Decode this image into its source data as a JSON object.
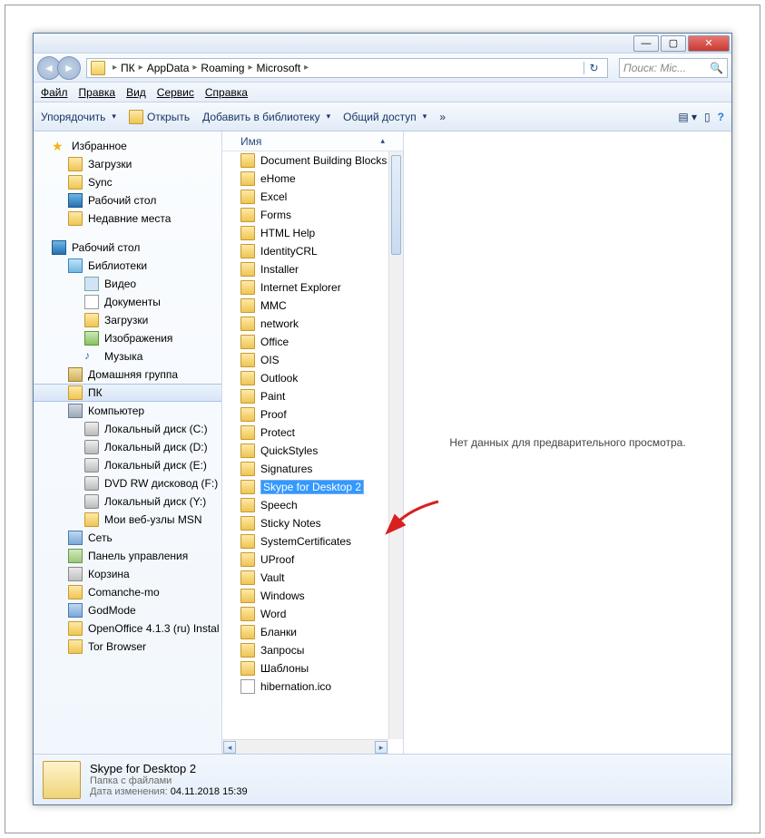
{
  "breadcrumb": {
    "items": [
      "ПК",
      "AppData",
      "Roaming",
      "Microsoft"
    ]
  },
  "search": {
    "placeholder": "Поиск: Mic..."
  },
  "menubar": {
    "file": "Файл",
    "edit": "Правка",
    "view": "Вид",
    "service": "Сервис",
    "help": "Справка"
  },
  "toolbar": {
    "organize": "Упорядочить",
    "open": "Открыть",
    "addlib": "Добавить в библиотеку",
    "share": "Общий доступ",
    "more": "»"
  },
  "sidebar": {
    "favorites": "Избранное",
    "downloads": "Загрузки",
    "sync": "Sync",
    "desktop": "Рабочий стол",
    "recent": "Недавние места",
    "desktop2": "Рабочий стол",
    "libraries": "Библиотеки",
    "video": "Видео",
    "documents": "Документы",
    "downloads2": "Загрузки",
    "images": "Изображения",
    "music": "Музыка",
    "homegroup": "Домашняя группа",
    "pc": "ПК",
    "computer": "Компьютер",
    "diskc": "Локальный диск (C:)",
    "diskd": "Локальный диск (D:)",
    "diske": "Локальный диск (E:)",
    "dvd": "DVD RW дисковод (F:)",
    "disky": "Локальный диск (Y:)",
    "msn": "Мои веб-узлы MSN",
    "network": "Сеть",
    "cpanel": "Панель управления",
    "recycle": "Корзина",
    "comanche": "Comanche-mo",
    "godmode": "GodMode",
    "openoffice": "OpenOffice 4.1.3 (ru) Instal",
    "tor": "Tor Browser"
  },
  "filelist": {
    "header": "Имя",
    "items": [
      "Document Building Blocks",
      "eHome",
      "Excel",
      "Forms",
      "HTML Help",
      "IdentityCRL",
      "Installer",
      "Internet Explorer",
      "MMC",
      "network",
      "Office",
      "OIS",
      "Outlook",
      "Paint",
      "Proof",
      "Protect",
      "QuickStyles",
      "Signatures",
      "Skype for Desktop 2",
      "Speech",
      "Sticky Notes",
      "SystemCertificates",
      "UProof",
      "Vault",
      "Windows",
      "Word",
      "Бланки",
      "Запросы",
      "Шаблоны",
      "hibernation.ico"
    ],
    "editing_index": 18
  },
  "preview": {
    "text": "Нет данных для предварительного просмотра."
  },
  "details": {
    "name": "Skype for Desktop 2",
    "type": "Папка с файлами",
    "date_label": "Дата изменения:",
    "date": "04.11.2018 15:39"
  }
}
